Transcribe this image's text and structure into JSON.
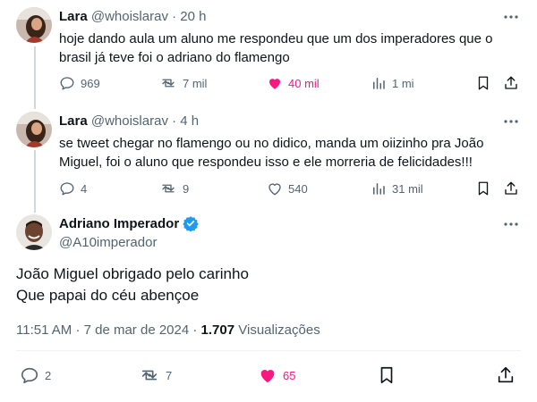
{
  "tweets": [
    {
      "name": "Lara",
      "handle": "@whoislarav",
      "separator": "·",
      "time": "20 h",
      "text_lines": [
        "hoje dando aula um aluno me respondeu que um dos imperadores que o",
        "brasil já teve foi o adriano do flamengo"
      ],
      "replies": "969",
      "retweets": "7 mil",
      "likes": "40 mil",
      "views": "1 mi",
      "liked": true
    },
    {
      "name": "Lara",
      "handle": "@whoislarav",
      "separator": "·",
      "time": "4 h",
      "text_lines": [
        "se tweet chegar no flamengo ou no didico, manda um oiizinho pra João",
        "Miguel, foi o aluno que respondeu isso e ele morreria de felicidades!!!"
      ],
      "replies": "4",
      "retweets": "9",
      "likes": "540",
      "views": "31 mil",
      "liked": false
    }
  ],
  "main_tweet": {
    "name": "Adriano Imperador",
    "verified": true,
    "handle": "@A10imperador",
    "text_lines": [
      "João Miguel obrigado pelo carinho",
      "Que papai do céu abençoe"
    ],
    "time": "11:51 AM",
    "separator": "·",
    "date": "7 de mar de 2024",
    "separator2": "·",
    "views_count": "1.707",
    "views_label": "Visualizações",
    "replies": "2",
    "retweets": "7",
    "likes": "65",
    "liked": true
  },
  "colors": {
    "text": "#0f1419",
    "secondary": "#536471",
    "like": "#f91880",
    "verified": "#1d9bf0",
    "thread_line": "#cfd9de"
  },
  "icons": [
    "more-icon",
    "reply-icon",
    "retweet-icon",
    "like-icon",
    "views-icon",
    "bookmark-icon",
    "share-icon",
    "verified-badge-icon"
  ]
}
